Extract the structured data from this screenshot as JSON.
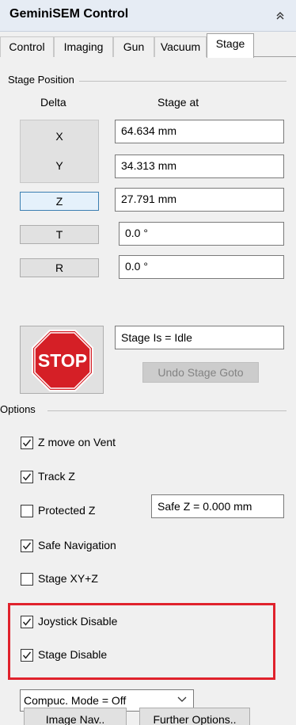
{
  "window": {
    "title": "GeminiSEM Control",
    "collapse_icon": "double-chevron-up-icon"
  },
  "tabs": [
    {
      "label": "Control",
      "active": false
    },
    {
      "label": "Imaging",
      "active": false
    },
    {
      "label": "Gun",
      "active": false
    },
    {
      "label": "Vacuum",
      "active": false
    },
    {
      "label": "Stage",
      "active": true
    }
  ],
  "stage_position": {
    "group_label": "Stage Position",
    "col_delta": "Delta",
    "col_stage_at": "Stage at",
    "axes": {
      "x": {
        "label": "X",
        "value": "64.634 mm"
      },
      "y": {
        "label": "Y",
        "value": "34.313 mm"
      },
      "z": {
        "label": "Z",
        "value": "27.791 mm"
      },
      "t": {
        "label": "T",
        "value": "0.0 °"
      },
      "r": {
        "label": "R",
        "value": "0.0 °"
      }
    }
  },
  "stop": {
    "label": "STOP",
    "icon": "stop-sign-icon"
  },
  "status": {
    "text": "Stage Is = Idle"
  },
  "undo_stage_goto": {
    "label": "Undo Stage Goto",
    "enabled": false
  },
  "options": {
    "group_label": "Options",
    "checks": {
      "z_move_on_vent": {
        "label": "Z move on Vent",
        "checked": true
      },
      "track_z": {
        "label": "Track Z",
        "checked": true
      },
      "protected_z": {
        "label": "Protected Z",
        "checked": false
      },
      "safe_navigation": {
        "label": "Safe Navigation",
        "checked": true
      },
      "stage_xyz": {
        "label": "Stage XY+Z",
        "checked": false
      },
      "joystick_disable": {
        "label": "Joystick Disable",
        "checked": true
      },
      "stage_disable": {
        "label": "Stage Disable",
        "checked": true
      }
    },
    "safe_z": "Safe Z =  0.000 mm",
    "compuc_mode": {
      "selected": "Compuc. Mode = Off"
    }
  },
  "buttons": {
    "image_nav": "Image Nav..",
    "further_options": "Further Options.."
  },
  "colors": {
    "highlight_outline": "#e0222c",
    "stop_red": "#d51f26"
  }
}
